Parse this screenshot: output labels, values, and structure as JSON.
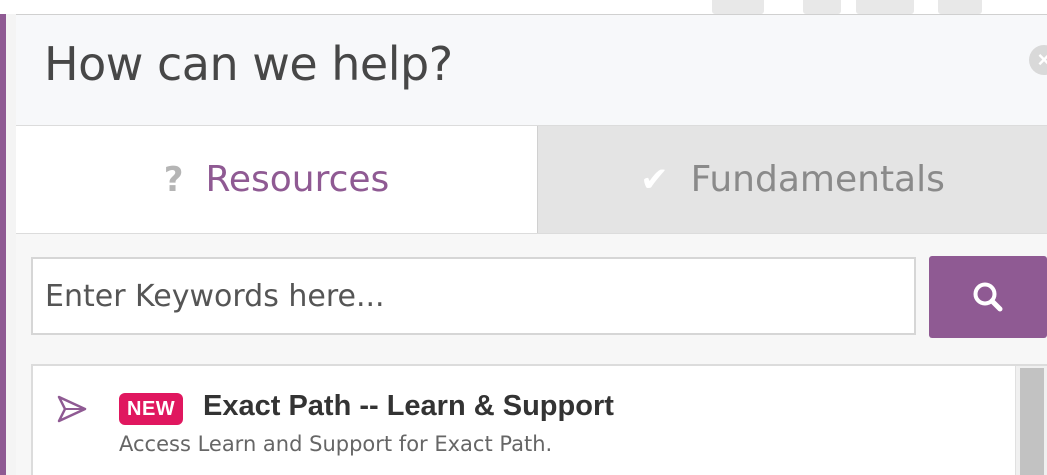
{
  "header": {
    "title": "How can we help?",
    "close_icon": "close-icon"
  },
  "tabs": [
    {
      "label": "Resources",
      "icon": "question-icon",
      "icon_glyph": "?",
      "active": true
    },
    {
      "label": "Fundamentals",
      "icon": "checkmark-icon",
      "icon_glyph": "✔",
      "active": false
    }
  ],
  "search": {
    "placeholder": "Enter Keywords here...",
    "button_icon": "search-icon"
  },
  "results": [
    {
      "badge": "NEW",
      "title": "Exact Path -- Learn & Support",
      "description": "Access Learn and Support for Exact Path.",
      "icon": "paper-plane-icon"
    }
  ],
  "colors": {
    "accent": "#8f5a93",
    "badge": "#e0175f",
    "inactive_tab_bg": "#e4e4e4"
  }
}
